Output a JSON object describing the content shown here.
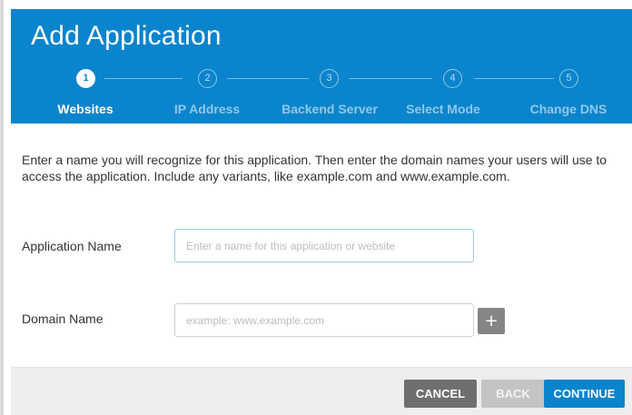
{
  "dialog": {
    "title": "Add Application"
  },
  "steps": [
    {
      "number": "1",
      "label": "Websites",
      "active": true
    },
    {
      "number": "2",
      "label": "IP Address",
      "active": false
    },
    {
      "number": "3",
      "label": "Backend Server",
      "active": false
    },
    {
      "number": "4",
      "label": "Select Mode",
      "active": false
    },
    {
      "number": "5",
      "label": "Change DNS",
      "active": false
    }
  ],
  "body": {
    "description": "Enter a name you will recognize for this application. Then enter the domain names your users will use to access the application. Include any variants, like example.com and www.example.com."
  },
  "form": {
    "application_name": {
      "label": "Application Name",
      "value": "",
      "placeholder": "Enter a name for this application or website"
    },
    "domain_name": {
      "label": "Domain Name",
      "value": "",
      "placeholder": "example: www.example.com"
    },
    "add_domain_label": "+"
  },
  "footer": {
    "cancel_label": "CANCEL",
    "back_label": "BACK",
    "continue_label": "CONTINUE"
  },
  "colors": {
    "accent": "#0a84cc",
    "cancel": "#6f6f6f",
    "back_disabled": "#c4c4c4"
  }
}
